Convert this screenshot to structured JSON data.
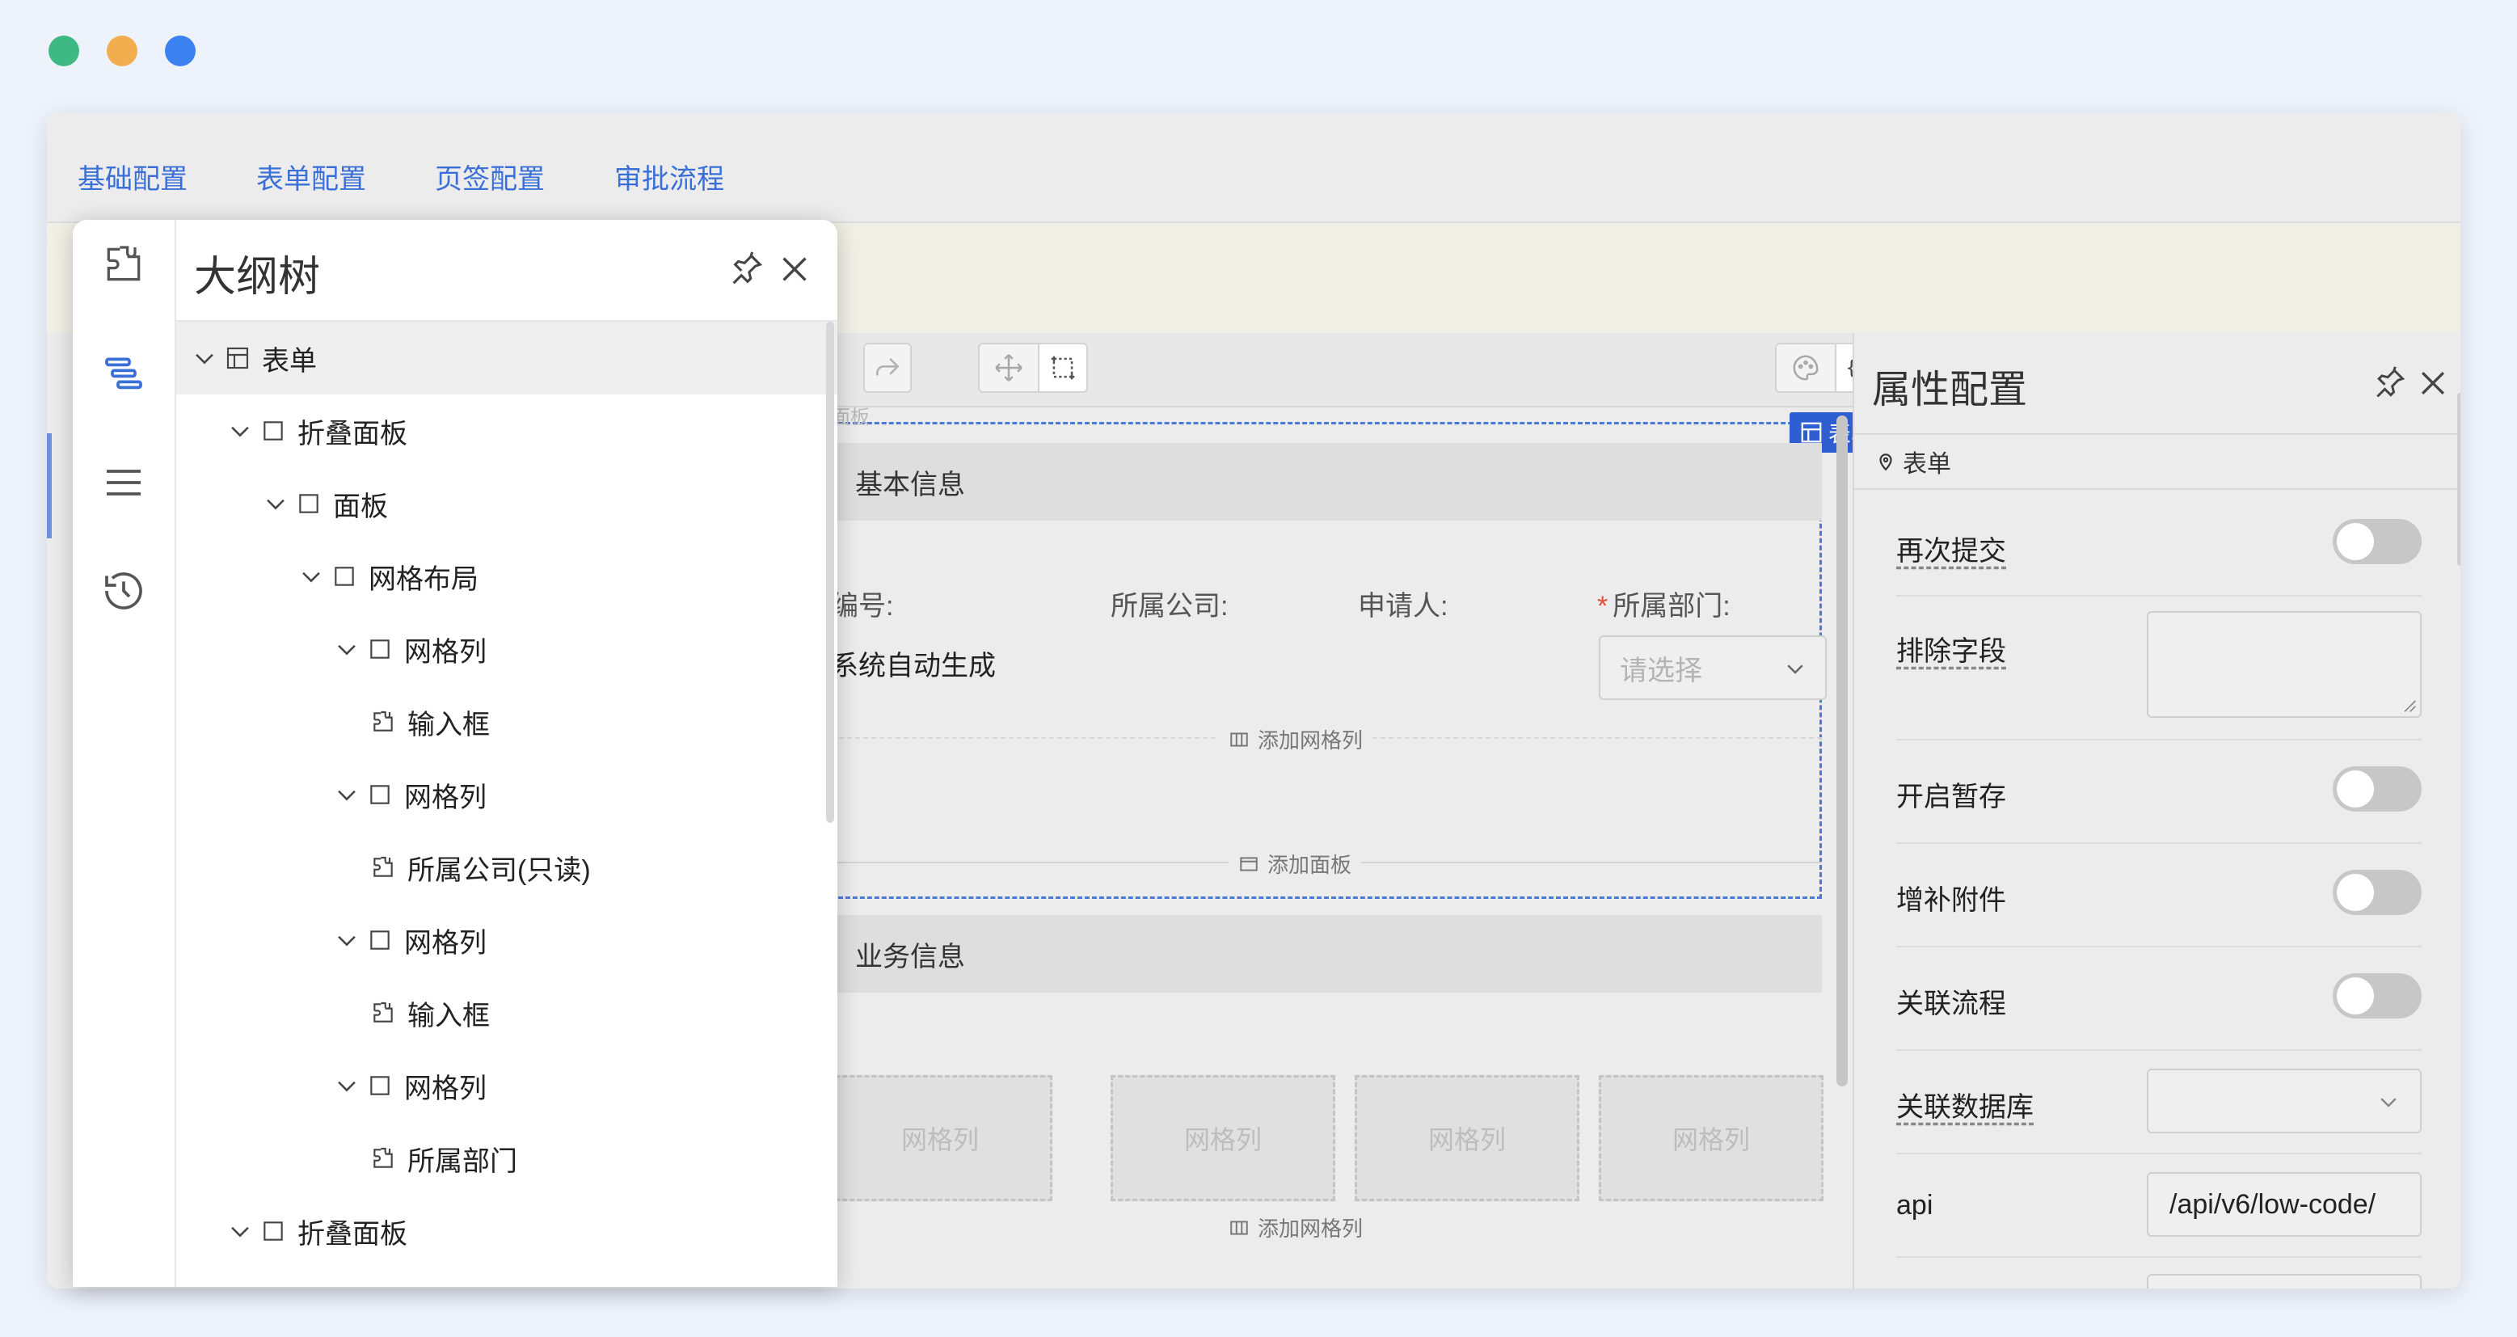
{
  "window_controls": [
    "close",
    "minimize",
    "maximize"
  ],
  "colors": {
    "close": "#3fb984",
    "minimize": "#f2ad4e",
    "maximize": "#3b82f0",
    "accent": "#3a6fd8",
    "selection": "#2f5ed1",
    "required": "#e34b3b"
  },
  "tabs": [
    "基础配置",
    "表单配置",
    "页签配置",
    "审批流程"
  ],
  "outline": {
    "title": "大纲树",
    "side_icons": [
      "component-icon",
      "outline-tree-icon",
      "menu-icon",
      "history-icon"
    ],
    "nodes": [
      {
        "label": "表单"
      },
      {
        "label": "折叠面板"
      },
      {
        "label": "面板"
      },
      {
        "label": "网格布局"
      },
      {
        "label": "网格列"
      },
      {
        "label": "输入框"
      },
      {
        "label": "网格列"
      },
      {
        "label": "所属公司(只读)"
      },
      {
        "label": "网格列"
      },
      {
        "label": "输入框"
      },
      {
        "label": "网格列"
      },
      {
        "label": "所属部门"
      },
      {
        "label": "折叠面板"
      }
    ]
  },
  "canvas": {
    "panel_hint": "面板",
    "selection_tag": "表单",
    "section1": {
      "title": "基本信息",
      "fields": [
        {
          "label": "编号:",
          "value": "系统自动生成"
        },
        {
          "label": "所属公司:"
        },
        {
          "label": "申请人:"
        },
        {
          "label": "所属部门:",
          "required": "*",
          "placeholder": "请选择"
        }
      ],
      "add_grid_col": "添加网格列",
      "add_panel": "添加面板"
    },
    "section2": {
      "title": "业务信息",
      "grid_cells": [
        "网格列",
        "网格列",
        "网格列",
        "网格列"
      ],
      "add_grid_col": "添加网格列"
    }
  },
  "properties": {
    "title": "属性配置",
    "crumb": "表单",
    "rows": [
      {
        "label": "再次提交",
        "kind": "toggle",
        "on": false
      },
      {
        "label": "排除字段",
        "kind": "textarea",
        "value": ""
      },
      {
        "label": "开启暂存",
        "kind": "toggle",
        "on": false
      },
      {
        "label": "增补附件",
        "kind": "toggle",
        "on": false
      },
      {
        "label": "关联流程",
        "kind": "toggle",
        "on": false
      },
      {
        "label": "关联数据库",
        "kind": "select",
        "value": ""
      },
      {
        "label": "api",
        "kind": "input",
        "value": "/api/v6/low-code/"
      }
    ]
  }
}
